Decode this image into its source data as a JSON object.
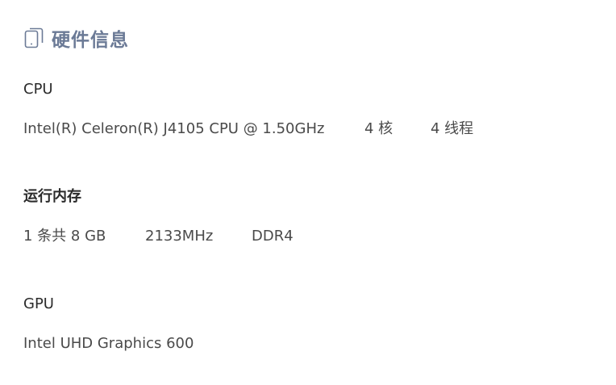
{
  "header": {
    "title": "硬件信息",
    "icon": "device-icon",
    "accent_color": "#6b7a96"
  },
  "cpu": {
    "label": "CPU",
    "model": "Intel(R) Celeron(R) J4105 CPU @ 1.50GHz",
    "cores": "4 核",
    "threads": "4 线程"
  },
  "memory": {
    "label": "运行内存",
    "capacity": "1 条共 8 GB",
    "frequency": "2133MHz",
    "type": "DDR4"
  },
  "gpu": {
    "label": "GPU",
    "model": "Intel UHD Graphics 600"
  }
}
